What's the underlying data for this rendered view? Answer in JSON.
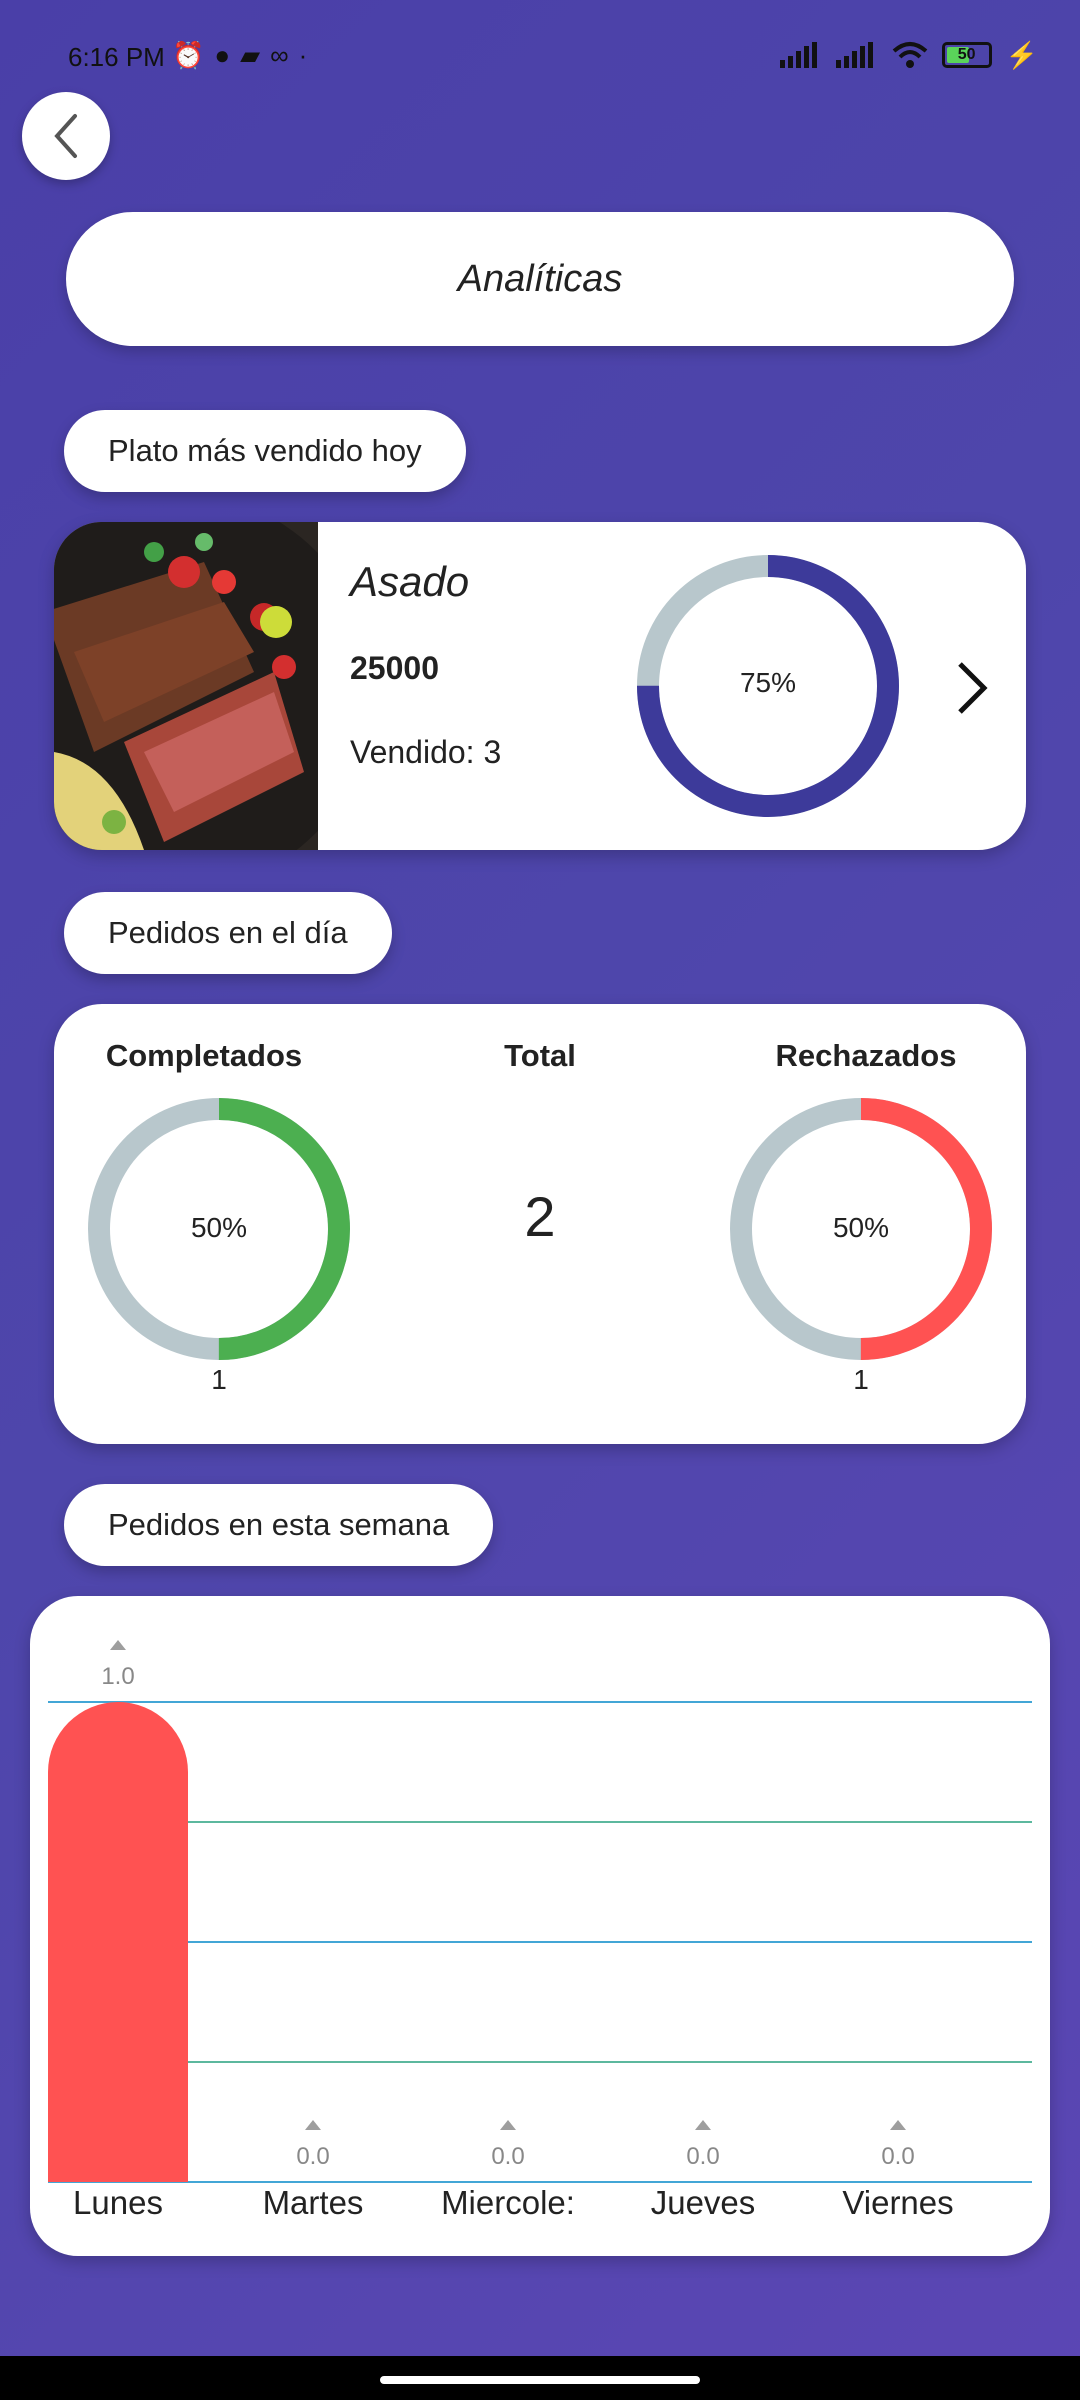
{
  "status_bar": {
    "time": "6:16 PM",
    "battery": "50"
  },
  "header": {
    "title": "Analíticas"
  },
  "top_dish": {
    "section_label": "Plato más vendido hoy",
    "name": "Asado",
    "price": "25000",
    "sold": "Vendido: 3",
    "percent_label": "75%",
    "percent": 0.75
  },
  "daily_orders": {
    "section_label": "Pedidos en el día",
    "completed": {
      "title": "Completados",
      "percent_label": "50%",
      "percent": 0.5,
      "count": "1"
    },
    "total": {
      "title": "Total",
      "value": "2"
    },
    "rejected": {
      "title": "Rechazados",
      "percent_label": "50%",
      "percent": 0.5,
      "count": "1"
    }
  },
  "weekly_orders": {
    "section_label": "Pedidos en esta semana"
  },
  "colors": {
    "accent_blue": "#3d3a9a",
    "ring_track": "#b8c7cc",
    "green": "#4caf50",
    "red": "#ff5252"
  },
  "chart_data": {
    "type": "bar",
    "categories": [
      "Lunes",
      "Martes",
      "Miercoles",
      "Jueves",
      "Viernes"
    ],
    "category_labels": [
      "Lunes",
      "Martes",
      "Miercole:",
      "Jueves",
      "Viernes"
    ],
    "values": [
      1.0,
      0.0,
      0.0,
      0.0,
      0.0
    ],
    "value_labels": [
      "1.0",
      "0.0",
      "0.0",
      "0.0",
      "0.0"
    ],
    "ylim": [
      0,
      1
    ],
    "grid": true,
    "bar_color": "#ff5252"
  }
}
